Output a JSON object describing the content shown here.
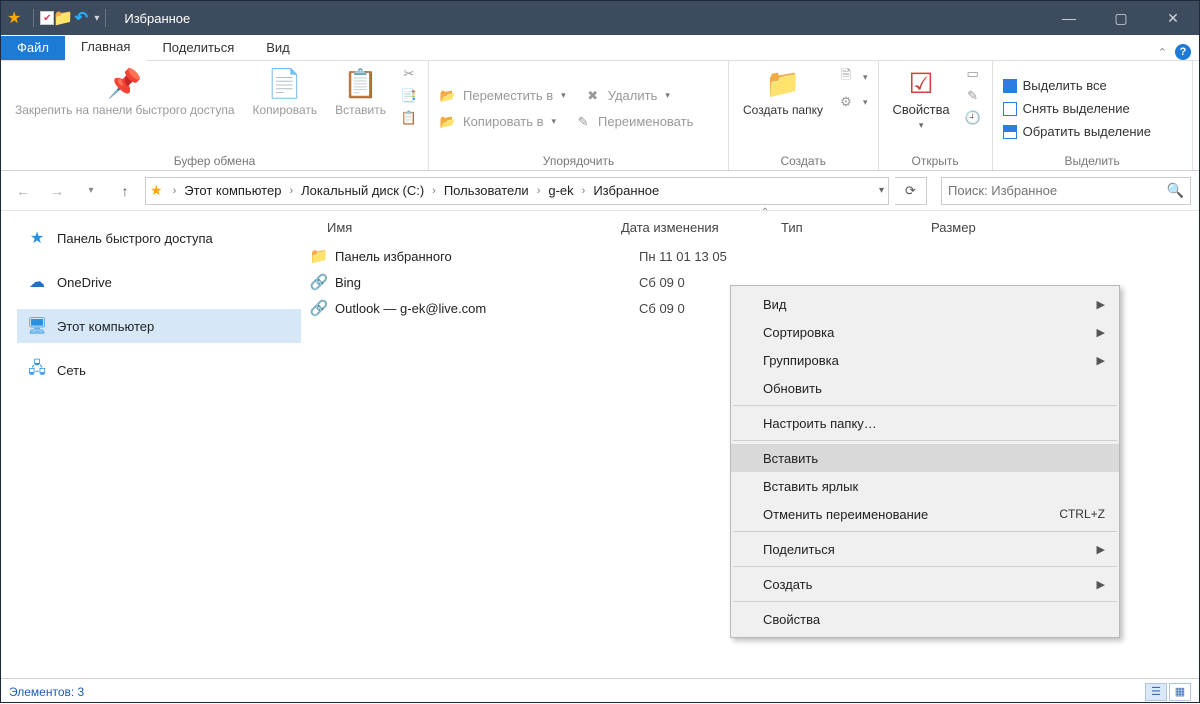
{
  "title": "Избранное",
  "tabs": {
    "file": "Файл",
    "home": "Главная",
    "share": "Поделиться",
    "view": "Вид"
  },
  "ribbon": {
    "clipboard": {
      "pin": "Закрепить на панели быстрого доступа",
      "copy": "Копировать",
      "paste": "Вставить",
      "caption": "Буфер обмена"
    },
    "organize": {
      "move": "Переместить в",
      "delete": "Удалить",
      "copyto": "Копировать в",
      "rename": "Переименовать",
      "caption": "Упорядочить"
    },
    "new": {
      "newfolder": "Создать папку",
      "caption": "Создать"
    },
    "open": {
      "properties": "Свойства",
      "caption": "Открыть"
    },
    "select": {
      "all": "Выделить все",
      "none": "Снять выделение",
      "invert": "Обратить выделение",
      "caption": "Выделить"
    }
  },
  "breadcrumb": {
    "items": [
      "Этот компьютер",
      "Локальный диск (C:)",
      "Пользователи",
      "g-ek",
      "Избранное"
    ]
  },
  "search": {
    "placeholder": "Поиск: Избранное"
  },
  "columns": {
    "name": "Имя",
    "date": "Дата изменения",
    "type": "Тип",
    "size": "Размер"
  },
  "sidebar": {
    "items": [
      {
        "label": "Панель быстрого доступа",
        "icon": "★",
        "color": "#2a90e0"
      },
      {
        "label": "OneDrive",
        "icon": "☁",
        "color": "#1e6fc7"
      },
      {
        "label": "Этот компьютер",
        "icon": "🖥",
        "color": "#2a90e0"
      },
      {
        "label": "Сеть",
        "icon": "🖧",
        "color": "#2a90e0"
      }
    ]
  },
  "files": [
    {
      "name": "Панель избранного",
      "date": "Пн 11 01 13 05",
      "icon": "folder"
    },
    {
      "name": "Bing",
      "date": "Сб 09 0",
      "icon": "bing"
    },
    {
      "name": "Outlook — g-ek@live.com",
      "date": "Сб 09 0",
      "icon": "outlook"
    }
  ],
  "context": {
    "view": "Вид",
    "sort": "Сортировка",
    "group": "Группировка",
    "refresh": "Обновить",
    "customize": "Настроить папку…",
    "paste": "Вставить",
    "paste_shortcut": "Вставить ярлык",
    "undo_rename": "Отменить переименование",
    "undo_key": "CTRL+Z",
    "share": "Поделиться",
    "create": "Создать",
    "properties": "Свойства"
  },
  "status": {
    "count_label": "Элементов: 3"
  }
}
